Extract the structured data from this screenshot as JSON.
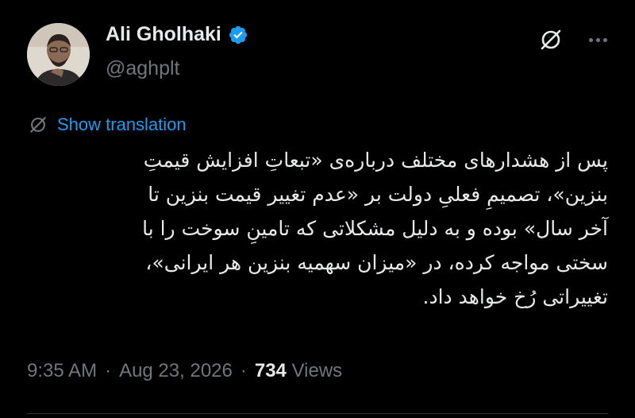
{
  "author": {
    "display_name": "Ali Gholhaki",
    "handle": "@aghplt",
    "verified": true,
    "avatar_icon": "profile-photo"
  },
  "actions": {
    "grok_icon": "grok-icon",
    "more_icon": "more-options-icon"
  },
  "translation": {
    "label": "Show translation",
    "icon": "translate-icon"
  },
  "tweet": {
    "text": "پس از هشدارهای مختلف درباره‌ی «تبعاتِ افزایش قیمتِ\nبنزین»، تصمیمِ فعلیِ دولت بر «عدم تغییر قیمت بنزین تا\nآخر سال» بوده و به دلیل مشکلاتی که تامینِ سوخت را با\nسختی مواجه کرده، در «میزان سهمیه بنزین هر ایرانی»،\nتغییراتی رُخ خواهد داد."
  },
  "meta": {
    "time": "9:35 AM",
    "sep1": "·",
    "date": "Aug 23, 2026",
    "sep2": "·",
    "views_count": "734",
    "views_label": "Views"
  },
  "colors": {
    "background": "#000000",
    "text_primary": "#e7e9ea",
    "text_secondary": "#71767b",
    "accent": "#1d9bf0"
  }
}
